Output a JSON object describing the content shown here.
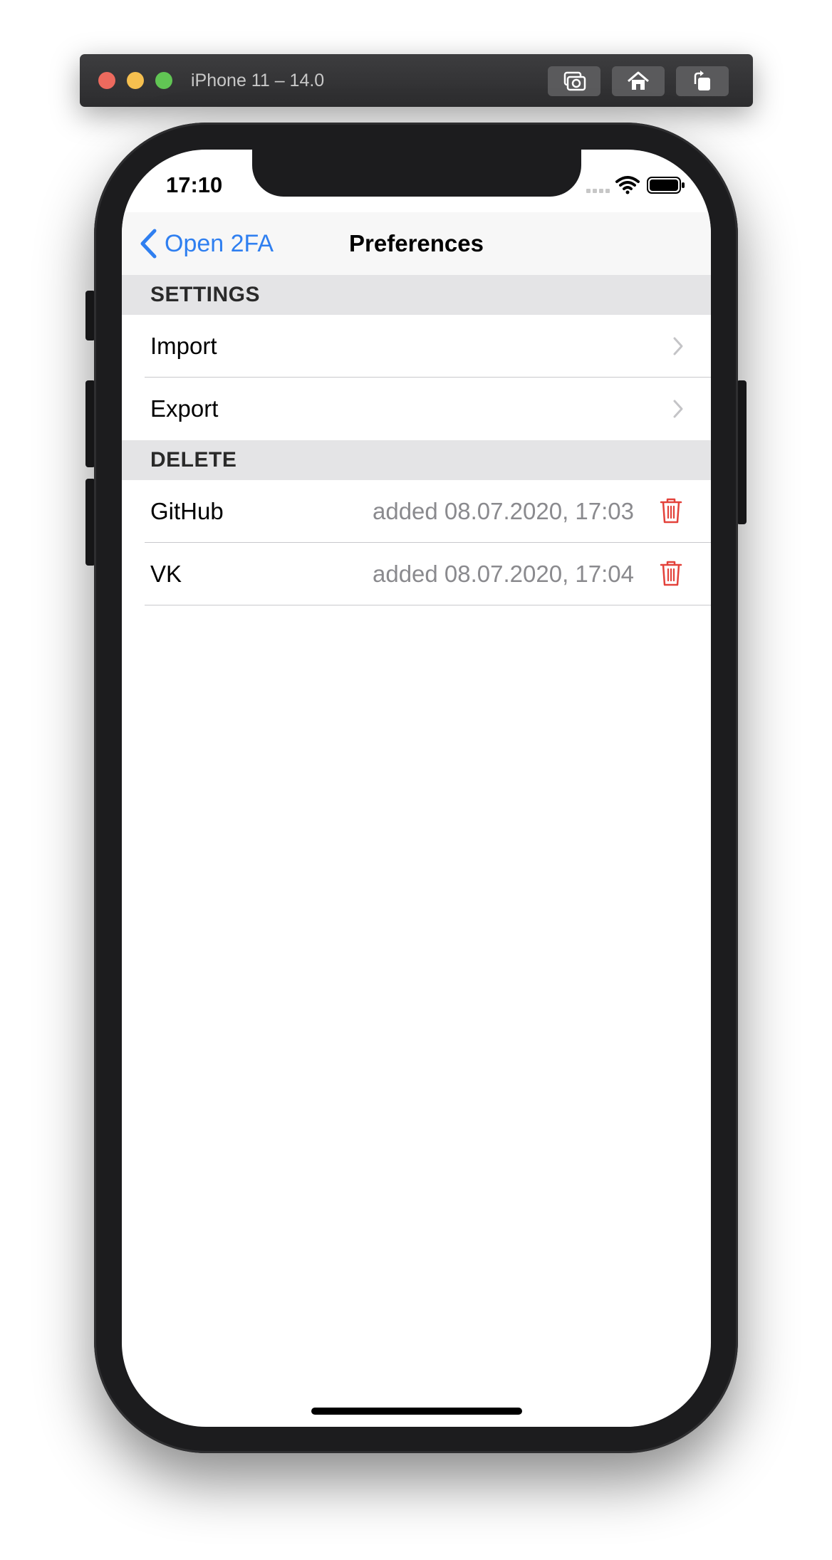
{
  "simulator": {
    "title": "iPhone 11 – 14.0",
    "buttons": [
      "screenshot-icon",
      "home-icon",
      "rotate-icon"
    ]
  },
  "status_bar": {
    "time": "17:10",
    "icons": [
      "cellular-icon",
      "wifi-icon",
      "battery-icon"
    ]
  },
  "navbar": {
    "back_label": "Open 2FA",
    "title": "Preferences"
  },
  "sections": {
    "settings": {
      "header": "SETTINGS",
      "items": [
        {
          "label": "Import"
        },
        {
          "label": "Export"
        }
      ]
    },
    "delete": {
      "header": "DELETE",
      "items": [
        {
          "label": "GitHub",
          "added": "added 08.07.2020, 17:03"
        },
        {
          "label": "VK",
          "added": "added 08.07.2020, 17:04"
        }
      ]
    }
  },
  "colors": {
    "accent": "#2f7ff0",
    "destructive": "#e3423b",
    "secondary_text": "#8a8a8e"
  }
}
